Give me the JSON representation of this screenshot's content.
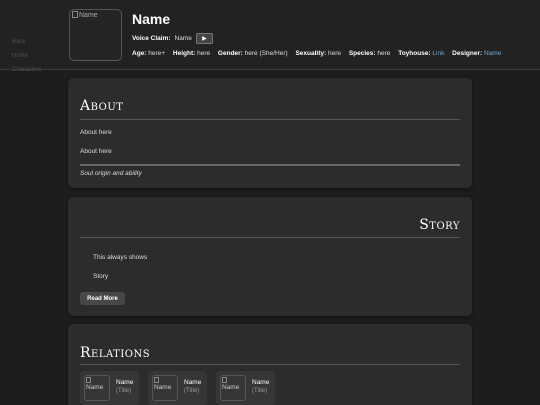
{
  "nav": {
    "items": [
      "Back",
      "Home",
      "Characters"
    ]
  },
  "profile": {
    "portrait_alt": "Name",
    "name": "Name",
    "voice_label": "Voice Claim:",
    "voice_value": "Name",
    "play_icon": "▶",
    "stats": [
      {
        "label": "Age:",
        "value": "here+",
        "link": false
      },
      {
        "label": "Height:",
        "value": "here",
        "link": false
      },
      {
        "label": "Gender:",
        "value": "here (She/Her)",
        "link": false
      },
      {
        "label": "Sexuality:",
        "value": "here",
        "link": false
      },
      {
        "label": "Species:",
        "value": "here",
        "link": false
      },
      {
        "label": "Toyhouse:",
        "value": "Link",
        "link": true
      },
      {
        "label": "Designer:",
        "value": "Name",
        "link": true
      }
    ]
  },
  "about": {
    "heading": "About",
    "line1": "About here",
    "line2": "About here",
    "caption": "Soul origin and ability"
  },
  "story": {
    "heading": "Story",
    "line1": "This always shows",
    "line2": "Story",
    "read_more": "Read More"
  },
  "relations": {
    "heading": "Relations",
    "items": [
      {
        "alt": "Name",
        "name": "Name",
        "title": "(Title)"
      },
      {
        "alt": "Name",
        "name": "Name",
        "title": "(Title)"
      },
      {
        "alt": "Name",
        "name": "Name",
        "title": "(Title)"
      }
    ]
  },
  "colors": {
    "background": "#1d1d1d",
    "card": "#2c2c2c",
    "link": "#6ea6d8",
    "button": "#474747"
  }
}
